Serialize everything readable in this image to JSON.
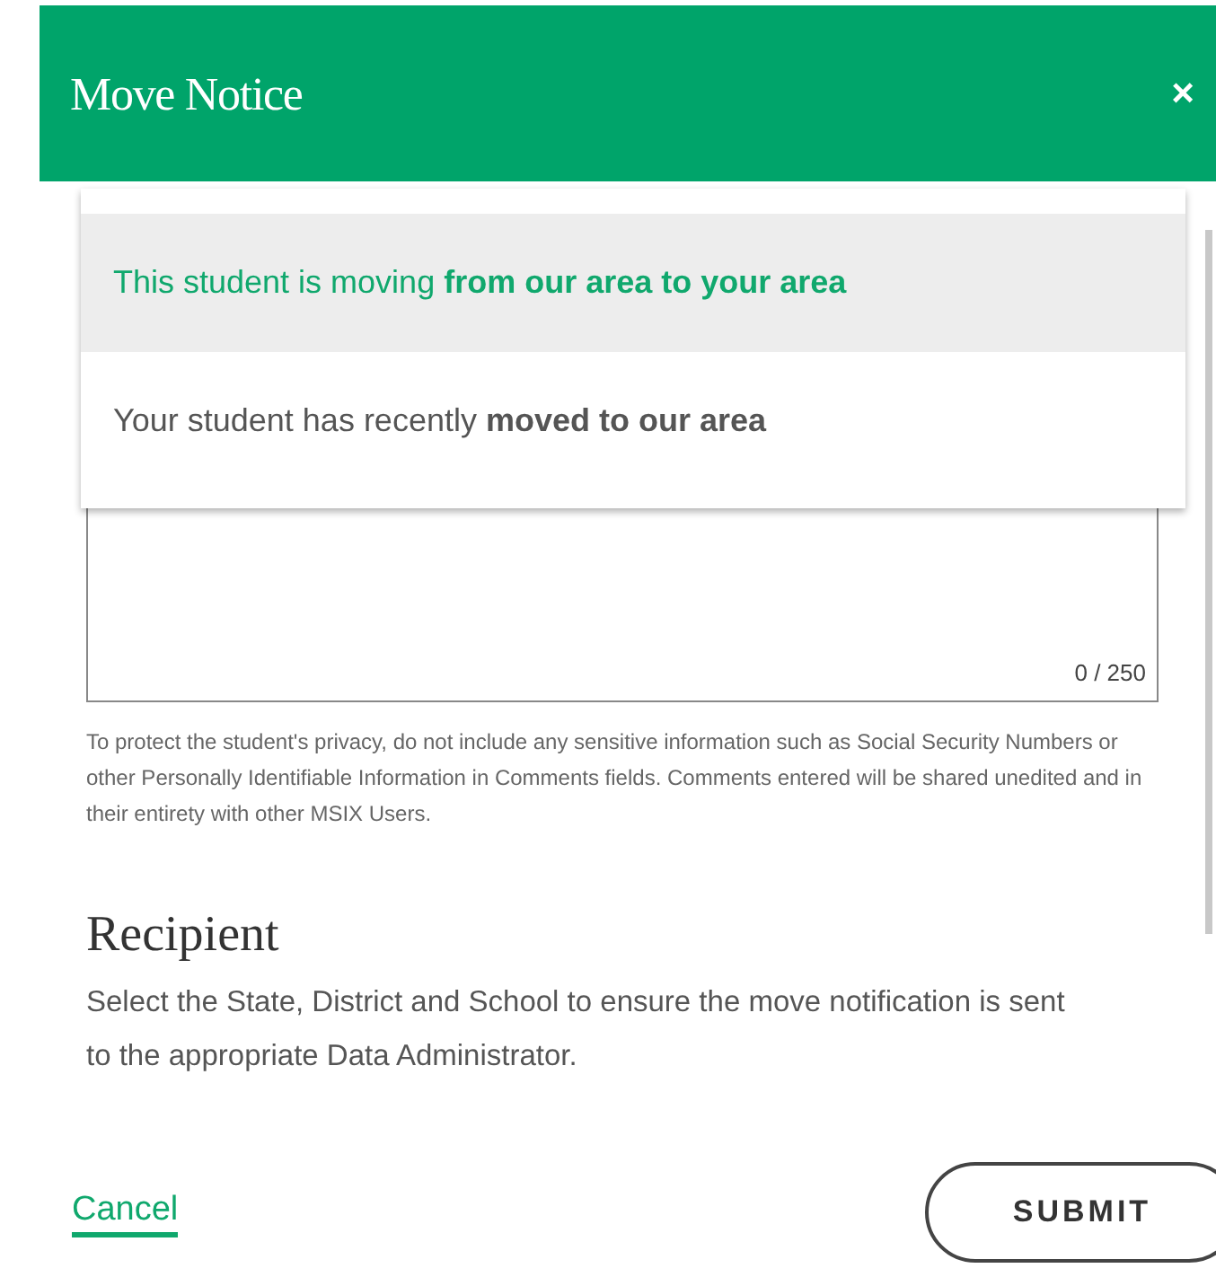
{
  "dialog": {
    "title": "Move Notice",
    "close": "×"
  },
  "options": [
    {
      "label": "This student is moving **from our area to your area**",
      "selected": true
    },
    {
      "label": "Your student has recently **moved to our area**",
      "selected": false
    }
  ],
  "comments": {
    "counter": "0 / 250"
  },
  "privacy_note": "To protect the student's privacy, do not include any sensitive information such as Social Security Numbers or other Personally Identifiable Information in Comments fields. Comments entered will be shared unedited and in their entirety with other MSIX Users.",
  "recipient": {
    "heading": "Recipient",
    "description": "Select the State, District and School to ensure the move notification is sent to the appropriate Data Administrator."
  },
  "buttons": {
    "cancel": "Cancel",
    "submit": "SUBMIT"
  }
}
